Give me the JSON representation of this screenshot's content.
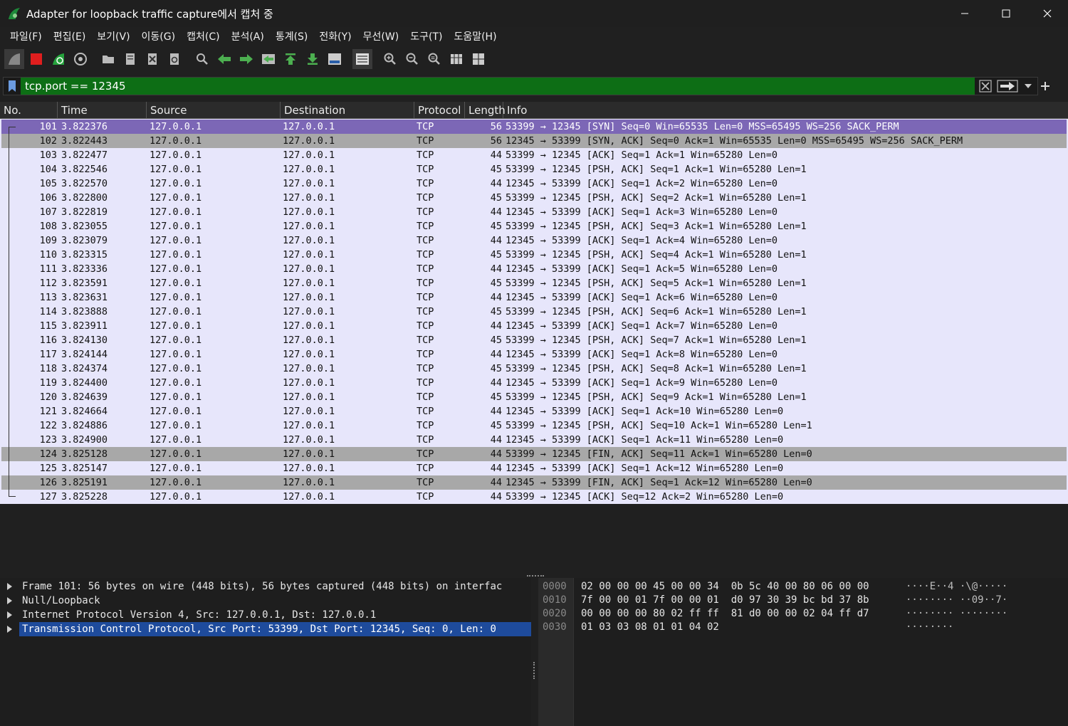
{
  "window": {
    "title": "Adapter for loopback traffic capture에서 캡처 중",
    "controls": [
      "minimize-icon",
      "maximize-icon",
      "close-icon"
    ]
  },
  "menu": [
    "파일(F)",
    "편집(E)",
    "보기(V)",
    "이동(G)",
    "캡처(C)",
    "분석(A)",
    "통계(S)",
    "전화(Y)",
    "무선(W)",
    "도구(T)",
    "도움말(H)"
  ],
  "toolbar": {
    "icons": [
      "start-capture-icon",
      "stop-capture-icon",
      "restart-capture-icon",
      "capture-options-icon",
      "open-file-icon",
      "save-file-icon",
      "close-file-icon",
      "reload-file-icon",
      "find-packet-icon",
      "go-back-icon",
      "go-forward-icon",
      "go-to-packet-icon",
      "go-first-icon",
      "go-last-icon",
      "auto-scroll-icon",
      "colorize-icon",
      "zoom-in-icon",
      "zoom-out-icon",
      "normal-size-icon",
      "resize-columns-icon",
      "layout-icon"
    ]
  },
  "filter": {
    "value": "tcp.port == 12345"
  },
  "columns": [
    "No.",
    "Time",
    "Source",
    "Destination",
    "Protocol",
    "Length",
    "Info"
  ],
  "packets": [
    {
      "no": "101",
      "time": "3.822376",
      "src": "127.0.0.1",
      "dst": "127.0.0.1",
      "proto": "TCP",
      "len": "56",
      "info": "53399 → 12345 [SYN] Seq=0 Win=65535 Len=0 MSS=65495 WS=256 SACK_PERM",
      "style": "sel"
    },
    {
      "no": "102",
      "time": "3.822443",
      "src": "127.0.0.1",
      "dst": "127.0.0.1",
      "proto": "TCP",
      "len": "56",
      "info": "12345 → 53399 [SYN, ACK] Seq=0 Ack=1 Win=65535 Len=0 MSS=65495 WS=256 SACK_PERM",
      "style": "gray"
    },
    {
      "no": "103",
      "time": "3.822477",
      "src": "127.0.0.1",
      "dst": "127.0.0.1",
      "proto": "TCP",
      "len": "44",
      "info": "53399 → 12345 [ACK] Seq=1 Ack=1 Win=65280 Len=0",
      "style": ""
    },
    {
      "no": "104",
      "time": "3.822546",
      "src": "127.0.0.1",
      "dst": "127.0.0.1",
      "proto": "TCP",
      "len": "45",
      "info": "53399 → 12345 [PSH, ACK] Seq=1 Ack=1 Win=65280 Len=1",
      "style": ""
    },
    {
      "no": "105",
      "time": "3.822570",
      "src": "127.0.0.1",
      "dst": "127.0.0.1",
      "proto": "TCP",
      "len": "44",
      "info": "12345 → 53399 [ACK] Seq=1 Ack=2 Win=65280 Len=0",
      "style": ""
    },
    {
      "no": "106",
      "time": "3.822800",
      "src": "127.0.0.1",
      "dst": "127.0.0.1",
      "proto": "TCP",
      "len": "45",
      "info": "53399 → 12345 [PSH, ACK] Seq=2 Ack=1 Win=65280 Len=1",
      "style": ""
    },
    {
      "no": "107",
      "time": "3.822819",
      "src": "127.0.0.1",
      "dst": "127.0.0.1",
      "proto": "TCP",
      "len": "44",
      "info": "12345 → 53399 [ACK] Seq=1 Ack=3 Win=65280 Len=0",
      "style": ""
    },
    {
      "no": "108",
      "time": "3.823055",
      "src": "127.0.0.1",
      "dst": "127.0.0.1",
      "proto": "TCP",
      "len": "45",
      "info": "53399 → 12345 [PSH, ACK] Seq=3 Ack=1 Win=65280 Len=1",
      "style": ""
    },
    {
      "no": "109",
      "time": "3.823079",
      "src": "127.0.0.1",
      "dst": "127.0.0.1",
      "proto": "TCP",
      "len": "44",
      "info": "12345 → 53399 [ACK] Seq=1 Ack=4 Win=65280 Len=0",
      "style": ""
    },
    {
      "no": "110",
      "time": "3.823315",
      "src": "127.0.0.1",
      "dst": "127.0.0.1",
      "proto": "TCP",
      "len": "45",
      "info": "53399 → 12345 [PSH, ACK] Seq=4 Ack=1 Win=65280 Len=1",
      "style": ""
    },
    {
      "no": "111",
      "time": "3.823336",
      "src": "127.0.0.1",
      "dst": "127.0.0.1",
      "proto": "TCP",
      "len": "44",
      "info": "12345 → 53399 [ACK] Seq=1 Ack=5 Win=65280 Len=0",
      "style": ""
    },
    {
      "no": "112",
      "time": "3.823591",
      "src": "127.0.0.1",
      "dst": "127.0.0.1",
      "proto": "TCP",
      "len": "45",
      "info": "53399 → 12345 [PSH, ACK] Seq=5 Ack=1 Win=65280 Len=1",
      "style": ""
    },
    {
      "no": "113",
      "time": "3.823631",
      "src": "127.0.0.1",
      "dst": "127.0.0.1",
      "proto": "TCP",
      "len": "44",
      "info": "12345 → 53399 [ACK] Seq=1 Ack=6 Win=65280 Len=0",
      "style": ""
    },
    {
      "no": "114",
      "time": "3.823888",
      "src": "127.0.0.1",
      "dst": "127.0.0.1",
      "proto": "TCP",
      "len": "45",
      "info": "53399 → 12345 [PSH, ACK] Seq=6 Ack=1 Win=65280 Len=1",
      "style": ""
    },
    {
      "no": "115",
      "time": "3.823911",
      "src": "127.0.0.1",
      "dst": "127.0.0.1",
      "proto": "TCP",
      "len": "44",
      "info": "12345 → 53399 [ACK] Seq=1 Ack=7 Win=65280 Len=0",
      "style": ""
    },
    {
      "no": "116",
      "time": "3.824130",
      "src": "127.0.0.1",
      "dst": "127.0.0.1",
      "proto": "TCP",
      "len": "45",
      "info": "53399 → 12345 [PSH, ACK] Seq=7 Ack=1 Win=65280 Len=1",
      "style": ""
    },
    {
      "no": "117",
      "time": "3.824144",
      "src": "127.0.0.1",
      "dst": "127.0.0.1",
      "proto": "TCP",
      "len": "44",
      "info": "12345 → 53399 [ACK] Seq=1 Ack=8 Win=65280 Len=0",
      "style": ""
    },
    {
      "no": "118",
      "time": "3.824374",
      "src": "127.0.0.1",
      "dst": "127.0.0.1",
      "proto": "TCP",
      "len": "45",
      "info": "53399 → 12345 [PSH, ACK] Seq=8 Ack=1 Win=65280 Len=1",
      "style": ""
    },
    {
      "no": "119",
      "time": "3.824400",
      "src": "127.0.0.1",
      "dst": "127.0.0.1",
      "proto": "TCP",
      "len": "44",
      "info": "12345 → 53399 [ACK] Seq=1 Ack=9 Win=65280 Len=0",
      "style": ""
    },
    {
      "no": "120",
      "time": "3.824639",
      "src": "127.0.0.1",
      "dst": "127.0.0.1",
      "proto": "TCP",
      "len": "45",
      "info": "53399 → 12345 [PSH, ACK] Seq=9 Ack=1 Win=65280 Len=1",
      "style": ""
    },
    {
      "no": "121",
      "time": "3.824664",
      "src": "127.0.0.1",
      "dst": "127.0.0.1",
      "proto": "TCP",
      "len": "44",
      "info": "12345 → 53399 [ACK] Seq=1 Ack=10 Win=65280 Len=0",
      "style": ""
    },
    {
      "no": "122",
      "time": "3.824886",
      "src": "127.0.0.1",
      "dst": "127.0.0.1",
      "proto": "TCP",
      "len": "45",
      "info": "53399 → 12345 [PSH, ACK] Seq=10 Ack=1 Win=65280 Len=1",
      "style": ""
    },
    {
      "no": "123",
      "time": "3.824900",
      "src": "127.0.0.1",
      "dst": "127.0.0.1",
      "proto": "TCP",
      "len": "44",
      "info": "12345 → 53399 [ACK] Seq=1 Ack=11 Win=65280 Len=0",
      "style": ""
    },
    {
      "no": "124",
      "time": "3.825128",
      "src": "127.0.0.1",
      "dst": "127.0.0.1",
      "proto": "TCP",
      "len": "44",
      "info": "53399 → 12345 [FIN, ACK] Seq=11 Ack=1 Win=65280 Len=0",
      "style": "gray"
    },
    {
      "no": "125",
      "time": "3.825147",
      "src": "127.0.0.1",
      "dst": "127.0.0.1",
      "proto": "TCP",
      "len": "44",
      "info": "12345 → 53399 [ACK] Seq=1 Ack=12 Win=65280 Len=0",
      "style": ""
    },
    {
      "no": "126",
      "time": "3.825191",
      "src": "127.0.0.1",
      "dst": "127.0.0.1",
      "proto": "TCP",
      "len": "44",
      "info": "12345 → 53399 [FIN, ACK] Seq=1 Ack=12 Win=65280 Len=0",
      "style": "gray"
    },
    {
      "no": "127",
      "time": "3.825228",
      "src": "127.0.0.1",
      "dst": "127.0.0.1",
      "proto": "TCP",
      "len": "44",
      "info": "53399 → 12345 [ACK] Seq=12 Ack=2 Win=65280 Len=0",
      "style": ""
    }
  ],
  "details": [
    {
      "text": "Frame 101: 56 bytes on wire (448 bits), 56 bytes captured (448 bits) on interfac",
      "selected": false
    },
    {
      "text": "Null/Loopback",
      "selected": false
    },
    {
      "text": "Internet Protocol Version 4, Src: 127.0.0.1, Dst: 127.0.0.1",
      "selected": false
    },
    {
      "text": "Transmission Control Protocol, Src Port: 53399, Dst Port: 12345, Seq: 0, Len: 0",
      "selected": true
    }
  ],
  "bytes": [
    {
      "offset": "0000",
      "hex": "02 00 00 00 45 00 00 34  0b 5c 40 00 80 06 00 00",
      "ascii": "····E··4 ·\\@·····"
    },
    {
      "offset": "0010",
      "hex": "7f 00 00 01 7f 00 00 01  d0 97 30 39 bc bd 37 8b",
      "ascii": "········ ··09··7·"
    },
    {
      "offset": "0020",
      "hex": "00 00 00 00 80 02 ff ff  81 d0 00 00 02 04 ff d7",
      "ascii": "········ ········"
    },
    {
      "offset": "0030",
      "hex": "01 03 03 08 01 01 04 02",
      "ascii": "········"
    }
  ],
  "colors": {
    "filter_valid": "#0d6e15",
    "row_selected": "#7c67b6",
    "row_gray": "#a8a8a8",
    "row_bg": "#e7e6fb",
    "detail_selected": "#1e4b9c"
  }
}
